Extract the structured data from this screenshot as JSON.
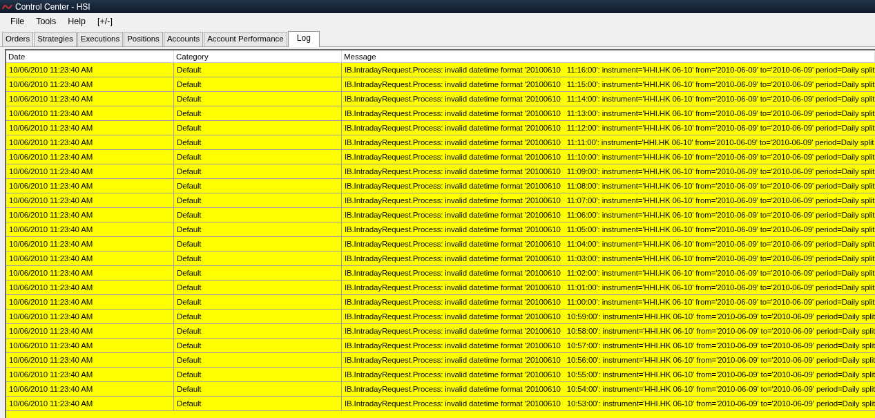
{
  "window": {
    "title": "Control Center - HSI"
  },
  "menu": [
    "File",
    "Tools",
    "Help",
    "[+/-]"
  ],
  "tabs": [
    {
      "label": "Orders",
      "selected": false
    },
    {
      "label": "Strategies",
      "selected": false
    },
    {
      "label": "Executions",
      "selected": false
    },
    {
      "label": "Positions",
      "selected": false
    },
    {
      "label": "Accounts",
      "selected": false
    },
    {
      "label": "Account Performance",
      "selected": false
    },
    {
      "label": "Log",
      "selected": true
    }
  ],
  "table": {
    "columns": [
      "Date",
      "Category",
      "Message"
    ],
    "rows": [
      [
        "10/06/2010 11:23:40 AM",
        "Default",
        "IB.IntradayRequest.Process: invalid datetime format '20100610   11:16:00': instrument='HHI.HK 06-10' from='2010-06-09' to='2010-06-09' period=Daily split"
      ],
      [
        "10/06/2010 11:23:40 AM",
        "Default",
        "IB.IntradayRequest.Process: invalid datetime format '20100610   11:15:00': instrument='HHI.HK 06-10' from='2010-06-09' to='2010-06-09' period=Daily split"
      ],
      [
        "10/06/2010 11:23:40 AM",
        "Default",
        "IB.IntradayRequest.Process: invalid datetime format '20100610   11:14:00': instrument='HHI.HK 06-10' from='2010-06-09' to='2010-06-09' period=Daily split"
      ],
      [
        "10/06/2010 11:23:40 AM",
        "Default",
        "IB.IntradayRequest.Process: invalid datetime format '20100610   11:13:00': instrument='HHI.HK 06-10' from='2010-06-09' to='2010-06-09' period=Daily split"
      ],
      [
        "10/06/2010 11:23:40 AM",
        "Default",
        "IB.IntradayRequest.Process: invalid datetime format '20100610   11:12:00': instrument='HHI.HK 06-10' from='2010-06-09' to='2010-06-09' period=Daily split"
      ],
      [
        "10/06/2010 11:23:40 AM",
        "Default",
        "IB.IntradayRequest.Process: invalid datetime format '20100610   11:11:00': instrument='HHI.HK 06-10' from='2010-06-09' to='2010-06-09' period=Daily split"
      ],
      [
        "10/06/2010 11:23:40 AM",
        "Default",
        "IB.IntradayRequest.Process: invalid datetime format '20100610   11:10:00': instrument='HHI.HK 06-10' from='2010-06-09' to='2010-06-09' period=Daily split"
      ],
      [
        "10/06/2010 11:23:40 AM",
        "Default",
        "IB.IntradayRequest.Process: invalid datetime format '20100610   11:09:00': instrument='HHI.HK 06-10' from='2010-06-09' to='2010-06-09' period=Daily split"
      ],
      [
        "10/06/2010 11:23:40 AM",
        "Default",
        "IB.IntradayRequest.Process: invalid datetime format '20100610   11:08:00': instrument='HHI.HK 06-10' from='2010-06-09' to='2010-06-09' period=Daily split"
      ],
      [
        "10/06/2010 11:23:40 AM",
        "Default",
        "IB.IntradayRequest.Process: invalid datetime format '20100610   11:07:00': instrument='HHI.HK 06-10' from='2010-06-09' to='2010-06-09' period=Daily split"
      ],
      [
        "10/06/2010 11:23:40 AM",
        "Default",
        "IB.IntradayRequest.Process: invalid datetime format '20100610   11:06:00': instrument='HHI.HK 06-10' from='2010-06-09' to='2010-06-09' period=Daily split"
      ],
      [
        "10/06/2010 11:23:40 AM",
        "Default",
        "IB.IntradayRequest.Process: invalid datetime format '20100610   11:05:00': instrument='HHI.HK 06-10' from='2010-06-09' to='2010-06-09' period=Daily split"
      ],
      [
        "10/06/2010 11:23:40 AM",
        "Default",
        "IB.IntradayRequest.Process: invalid datetime format '20100610   11:04:00': instrument='HHI.HK 06-10' from='2010-06-09' to='2010-06-09' period=Daily split"
      ],
      [
        "10/06/2010 11:23:40 AM",
        "Default",
        "IB.IntradayRequest.Process: invalid datetime format '20100610   11:03:00': instrument='HHI.HK 06-10' from='2010-06-09' to='2010-06-09' period=Daily split"
      ],
      [
        "10/06/2010 11:23:40 AM",
        "Default",
        "IB.IntradayRequest.Process: invalid datetime format '20100610   11:02:00': instrument='HHI.HK 06-10' from='2010-06-09' to='2010-06-09' period=Daily split"
      ],
      [
        "10/06/2010 11:23:40 AM",
        "Default",
        "IB.IntradayRequest.Process: invalid datetime format '20100610   11:01:00': instrument='HHI.HK 06-10' from='2010-06-09' to='2010-06-09' period=Daily split"
      ],
      [
        "10/06/2010 11:23:40 AM",
        "Default",
        "IB.IntradayRequest.Process: invalid datetime format '20100610   11:00:00': instrument='HHI.HK 06-10' from='2010-06-09' to='2010-06-09' period=Daily split"
      ],
      [
        "10/06/2010 11:23:40 AM",
        "Default",
        "IB.IntradayRequest.Process: invalid datetime format '20100610   10:59:00': instrument='HHI.HK 06-10' from='2010-06-09' to='2010-06-09' period=Daily split"
      ],
      [
        "10/06/2010 11:23:40 AM",
        "Default",
        "IB.IntradayRequest.Process: invalid datetime format '20100610   10:58:00': instrument='HHI.HK 06-10' from='2010-06-09' to='2010-06-09' period=Daily split"
      ],
      [
        "10/06/2010 11:23:40 AM",
        "Default",
        "IB.IntradayRequest.Process: invalid datetime format '20100610   10:57:00': instrument='HHI.HK 06-10' from='2010-06-09' to='2010-06-09' period=Daily split"
      ],
      [
        "10/06/2010 11:23:40 AM",
        "Default",
        "IB.IntradayRequest.Process: invalid datetime format '20100610   10:56:00': instrument='HHI.HK 06-10' from='2010-06-09' to='2010-06-09' period=Daily split"
      ],
      [
        "10/06/2010 11:23:40 AM",
        "Default",
        "IB.IntradayRequest.Process: invalid datetime format '20100610   10:55:00': instrument='HHI.HK 06-10' from='2010-06-09' to='2010-06-09' period=Daily split"
      ],
      [
        "10/06/2010 11:23:40 AM",
        "Default",
        "IB.IntradayRequest.Process: invalid datetime format '20100610   10:54:00': instrument='HHI.HK 06-10' from='2010-06-09' to='2010-06-09' period=Daily split"
      ],
      [
        "10/06/2010 11:23:40 AM",
        "Default",
        "IB.IntradayRequest.Process: invalid datetime format '20100610   10:53:00': instrument='HHI.HK 06-10' from='2010-06-09' to='2010-06-09' period=Daily split"
      ]
    ]
  }
}
